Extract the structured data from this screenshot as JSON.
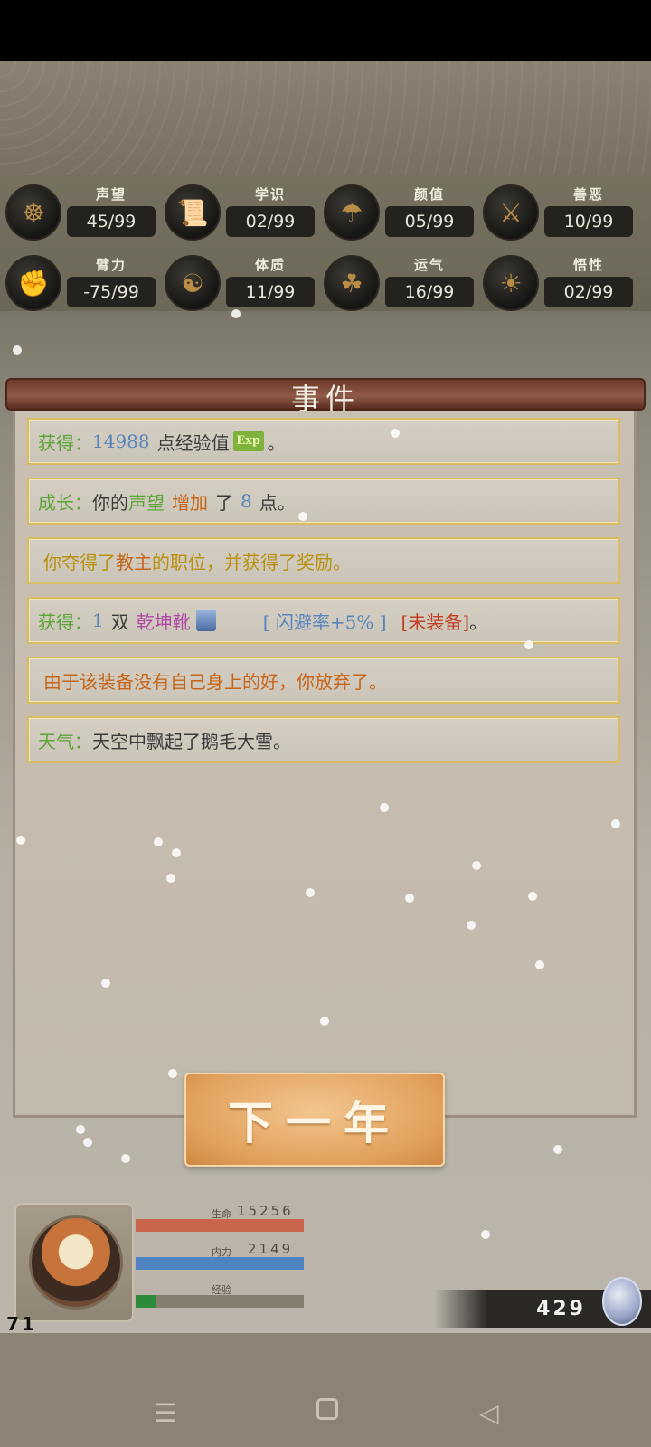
{
  "stats": [
    {
      "label": "声望",
      "value": "45/99",
      "icon": "reputation-icon",
      "glyph": "☸"
    },
    {
      "label": "学识",
      "value": "02/99",
      "icon": "scroll-icon",
      "glyph": "📜"
    },
    {
      "label": "颜值",
      "value": "05/99",
      "icon": "hat-icon",
      "glyph": "☂"
    },
    {
      "label": "善恶",
      "value": "10/99",
      "icon": "swords-icon",
      "glyph": "⚔"
    },
    {
      "label": "臂力",
      "value": "-75/99",
      "icon": "strength-icon",
      "glyph": "✊"
    },
    {
      "label": "体质",
      "value": "11/99",
      "icon": "body-icon",
      "glyph": "☯"
    },
    {
      "label": "运气",
      "value": "16/99",
      "icon": "luck-icon",
      "glyph": "☘"
    },
    {
      "label": "悟性",
      "value": "02/99",
      "icon": "insight-icon",
      "glyph": "☀"
    }
  ],
  "panel": {
    "title": "事件"
  },
  "events": {
    "e1": {
      "prefix": "获得：",
      "amount": "14988",
      "text": "点经验值",
      "exp_label": "Exp",
      "end": "。"
    },
    "e2": {
      "prefix": "成长：",
      "t1": "你的",
      "attr": "声望",
      "verb": "增加",
      "t2": "了",
      "amount": "8",
      "t3": "点。"
    },
    "e3": {
      "text": "你夺得了",
      "role": "教主",
      "text2": "的职位，并获得了奖励。"
    },
    "e4": {
      "prefix": "获得：",
      "amount": "1",
      "unit": "双",
      "item": "乾坤靴",
      "attr": "[ 闪避率+5% ]",
      "tag": "[未装备]",
      "end": "。"
    },
    "e5": {
      "text": "由于该装备没有自己身上的好，你放弃了。"
    },
    "e6": {
      "prefix": "天气：",
      "text": "天空中飘起了鹅毛大雪。"
    }
  },
  "next_button": "下一年",
  "player": {
    "level": "71",
    "hp_label": "生命",
    "hp_value": "15256",
    "hp_fill": 1.0,
    "mp_label": "内力",
    "mp_value": "2149",
    "mp_fill": 1.0,
    "exp_label": "经验",
    "exp_fill": 0.12
  },
  "gold": "429",
  "colors": {
    "hp": "#c8654c",
    "mp": "#4f82c0",
    "exp": "#2d8a3a"
  },
  "nav": {
    "menu_icon": "menu-icon",
    "home_icon": "home-icon",
    "back_icon": "back-icon"
  }
}
